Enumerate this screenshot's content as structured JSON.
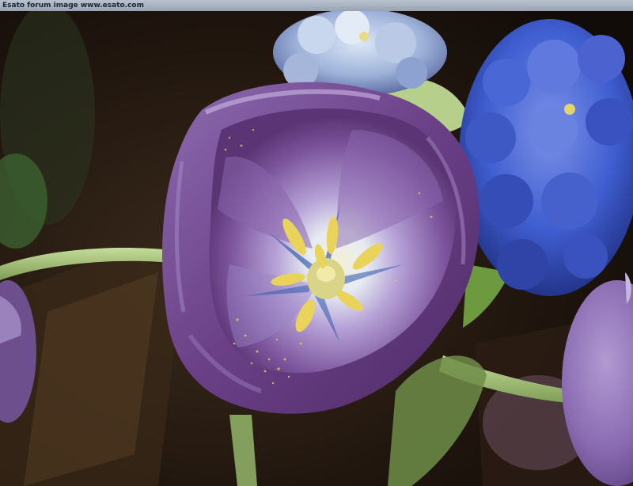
{
  "caption": "Esato forum image www.esato.com",
  "colors": {
    "background_dark": "#1a1410",
    "tulip_purple": "#6a3f86",
    "tulip_light": "#b7a3d8",
    "hyacinth_blue": "#3f5ed0",
    "stem_green": "#9fc27a",
    "stamen_yellow": "#e9d35a"
  },
  "icons": {
    "photo": "tulip-and-hyacinth-photo"
  }
}
